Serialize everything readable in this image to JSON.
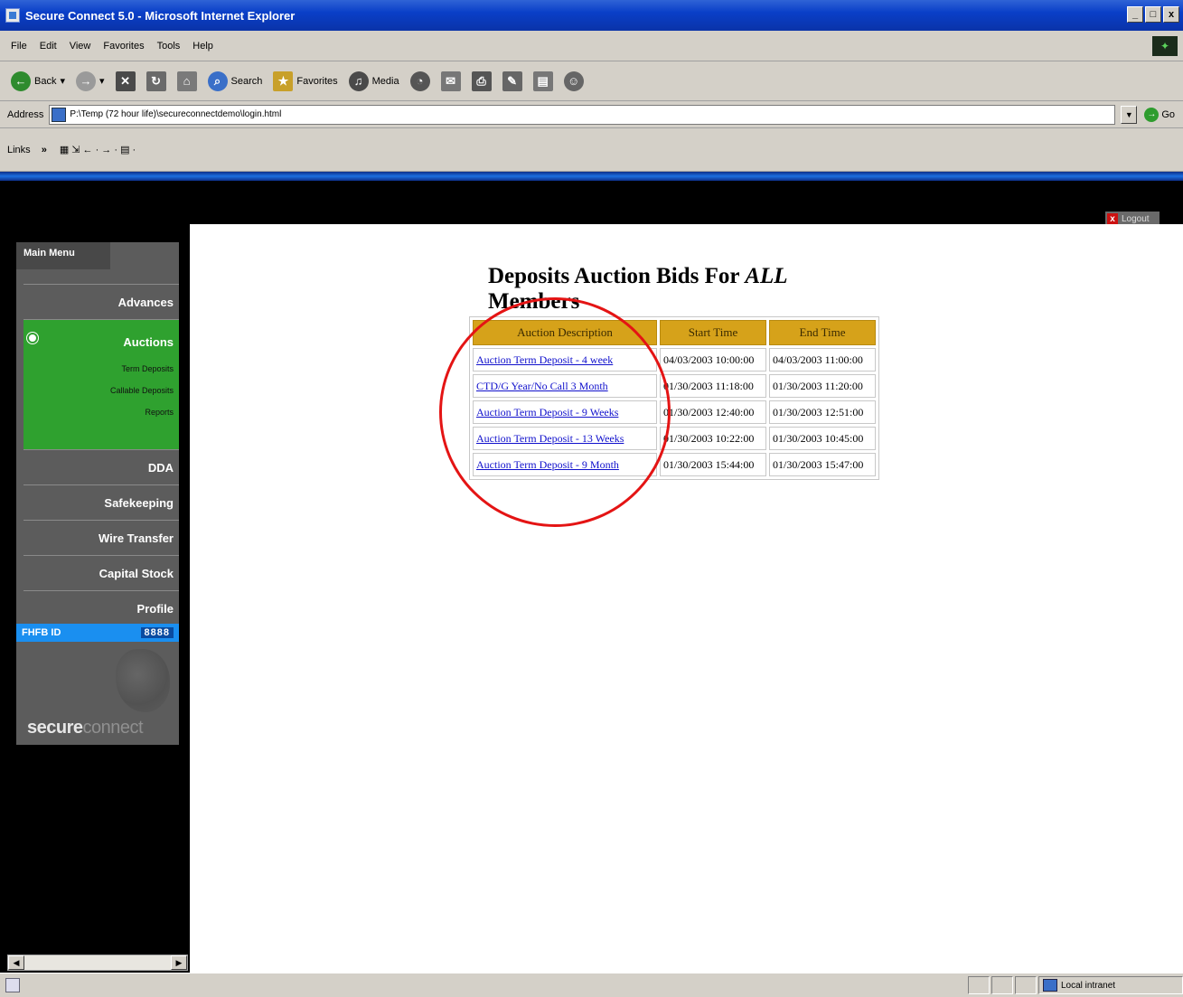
{
  "window": {
    "title": "Secure Connect 5.0 - Microsoft Internet Explorer",
    "controls": [
      "_",
      "□",
      "x"
    ]
  },
  "menu": [
    "File",
    "Edit",
    "View",
    "Favorites",
    "Tools",
    "Help"
  ],
  "toolbar": {
    "back": "Back",
    "search": "Search",
    "favorites": "Favorites",
    "media": "Media"
  },
  "address": {
    "label": "Address",
    "value": "P:\\Temp (72 hour life)\\secureconnectdemo\\login.html",
    "go": "Go"
  },
  "links": {
    "label": "Links",
    "chevron": "»"
  },
  "logout": "Logout",
  "page": {
    "title_prefix": "Deposits Auction Bids For ",
    "title_em": "ALL",
    "title_suffix": " Members"
  },
  "table": {
    "headers": [
      "Auction Description",
      "Start Time",
      "End Time"
    ],
    "rows": [
      {
        "description": "Auction Term Deposit - 4 week",
        "start": "04/03/2003 10:00:00",
        "end": "04/03/2003 11:00:00"
      },
      {
        "description": "CTD/G Year/No Call 3 Month",
        "start": "01/30/2003 11:18:00",
        "end": "01/30/2003 11:20:00"
      },
      {
        "description": "Auction Term Deposit - 9 Weeks",
        "start": "01/30/2003 12:40:00",
        "end": "01/30/2003 12:51:00"
      },
      {
        "description": "Auction Term Deposit - 13 Weeks",
        "start": "01/30/2003 10:22:00",
        "end": "01/30/2003 10:45:00"
      },
      {
        "description": "Auction Term Deposit - 9 Month",
        "start": "01/30/2003 15:44:00",
        "end": "01/30/2003 15:47:00"
      }
    ]
  },
  "sidebar": {
    "tab": "Main Menu",
    "items": [
      {
        "label": "Advances"
      },
      {
        "label": "Auctions",
        "active": true,
        "sub": [
          "Term Deposits",
          "Callable Deposits",
          "Reports"
        ]
      },
      {
        "label": "DDA"
      },
      {
        "label": "Safekeeping"
      },
      {
        "label": "Wire Transfer"
      },
      {
        "label": "Capital Stock"
      },
      {
        "label": "Profile"
      }
    ],
    "fhfb_label": "FHFB ID",
    "fhfb_value": "8888",
    "brand_hl": "secure",
    "brand_lo": "connect"
  },
  "status": {
    "zone": "Local intranet"
  },
  "colors": {
    "header_gold": "#d6a21a",
    "active_green": "#2fa12f",
    "highlight_circle": "#e41414",
    "fhfb_blue": "#1a8ff0"
  }
}
